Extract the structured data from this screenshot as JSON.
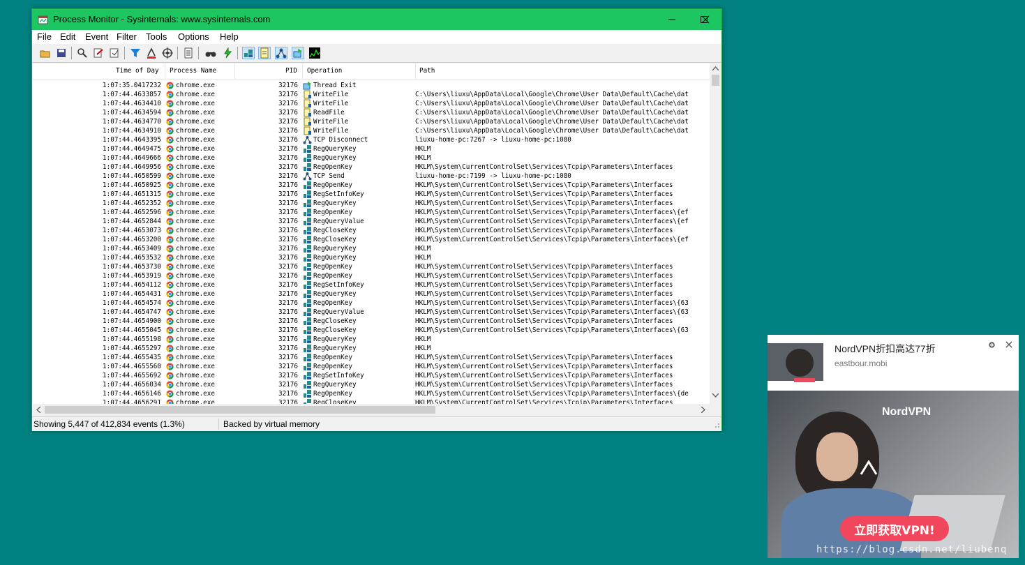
{
  "window": {
    "title": "Process Monitor - Sysinternals: www.sysinternals.com",
    "menu": [
      "File",
      "Edit",
      "Event",
      "Filter",
      "Tools",
      "Options",
      "Help"
    ]
  },
  "toolbar": {
    "icons": [
      "open-icon",
      "save-icon",
      "magnify-icon",
      "capture-icon",
      "autoscroll-icon",
      "clear-icon",
      "filter-icon",
      "highlight-icon",
      "target-icon",
      "tree-icon",
      "find-icon",
      "jump-icon",
      "registry-activity-icon",
      "file-activity-icon",
      "network-activity-icon",
      "process-activity-icon",
      "profiling-icon"
    ]
  },
  "columns": {
    "time": "Time of Day",
    "process": "Process Name",
    "pid": "PID",
    "operation": "Operation",
    "path": "Path"
  },
  "rows": [
    {
      "time": "1:07:35.0417232",
      "process": "chrome.exe",
      "pid": "32176",
      "op": "Thread Exit",
      "path": "",
      "kind": "thread"
    },
    {
      "time": "1:07:44.4633857",
      "process": "chrome.exe",
      "pid": "32176",
      "op": "WriteFile",
      "path": "C:\\Users\\liuxu\\AppData\\Local\\Google\\Chrome\\User Data\\Default\\Cache\\dat",
      "kind": "file"
    },
    {
      "time": "1:07:44.4634410",
      "process": "chrome.exe",
      "pid": "32176",
      "op": "WriteFile",
      "path": "C:\\Users\\liuxu\\AppData\\Local\\Google\\Chrome\\User Data\\Default\\Cache\\dat",
      "kind": "file"
    },
    {
      "time": "1:07:44.4634594",
      "process": "chrome.exe",
      "pid": "32176",
      "op": "ReadFile",
      "path": "C:\\Users\\liuxu\\AppData\\Local\\Google\\Chrome\\User Data\\Default\\Cache\\dat",
      "kind": "file"
    },
    {
      "time": "1:07:44.4634770",
      "process": "chrome.exe",
      "pid": "32176",
      "op": "WriteFile",
      "path": "C:\\Users\\liuxu\\AppData\\Local\\Google\\Chrome\\User Data\\Default\\Cache\\dat",
      "kind": "file"
    },
    {
      "time": "1:07:44.4634910",
      "process": "chrome.exe",
      "pid": "32176",
      "op": "WriteFile",
      "path": "C:\\Users\\liuxu\\AppData\\Local\\Google\\Chrome\\User Data\\Default\\Cache\\dat",
      "kind": "file"
    },
    {
      "time": "1:07:44.4643395",
      "process": "chrome.exe",
      "pid": "32176",
      "op": "TCP Disconnect",
      "path": "liuxu-home-pc:7267 -> liuxu-home-pc:1080",
      "kind": "net"
    },
    {
      "time": "1:07:44.4649475",
      "process": "chrome.exe",
      "pid": "32176",
      "op": "RegQueryKey",
      "path": "HKLM",
      "kind": "reg"
    },
    {
      "time": "1:07:44.4649666",
      "process": "chrome.exe",
      "pid": "32176",
      "op": "RegQueryKey",
      "path": "HKLM",
      "kind": "reg"
    },
    {
      "time": "1:07:44.4649956",
      "process": "chrome.exe",
      "pid": "32176",
      "op": "RegOpenKey",
      "path": "HKLM\\System\\CurrentControlSet\\Services\\Tcpip\\Parameters\\Interfaces",
      "kind": "reg"
    },
    {
      "time": "1:07:44.4650599",
      "process": "chrome.exe",
      "pid": "32176",
      "op": "TCP Send",
      "path": "liuxu-home-pc:7199 -> liuxu-home-pc:1080",
      "kind": "net"
    },
    {
      "time": "1:07:44.4650925",
      "process": "chrome.exe",
      "pid": "32176",
      "op": "RegOpenKey",
      "path": "HKLM\\System\\CurrentControlSet\\Services\\Tcpip\\Parameters\\Interfaces",
      "kind": "reg"
    },
    {
      "time": "1:07:44.4651315",
      "process": "chrome.exe",
      "pid": "32176",
      "op": "RegSetInfoKey",
      "path": "HKLM\\System\\CurrentControlSet\\Services\\Tcpip\\Parameters\\Interfaces",
      "kind": "reg"
    },
    {
      "time": "1:07:44.4652352",
      "process": "chrome.exe",
      "pid": "32176",
      "op": "RegQueryKey",
      "path": "HKLM\\System\\CurrentControlSet\\Services\\Tcpip\\Parameters\\Interfaces",
      "kind": "reg"
    },
    {
      "time": "1:07:44.4652596",
      "process": "chrome.exe",
      "pid": "32176",
      "op": "RegOpenKey",
      "path": "HKLM\\System\\CurrentControlSet\\Services\\Tcpip\\Parameters\\Interfaces\\{ef",
      "kind": "reg"
    },
    {
      "time": "1:07:44.4652844",
      "process": "chrome.exe",
      "pid": "32176",
      "op": "RegQueryValue",
      "path": "HKLM\\System\\CurrentControlSet\\Services\\Tcpip\\Parameters\\Interfaces\\{ef",
      "kind": "reg"
    },
    {
      "time": "1:07:44.4653073",
      "process": "chrome.exe",
      "pid": "32176",
      "op": "RegCloseKey",
      "path": "HKLM\\System\\CurrentControlSet\\Services\\Tcpip\\Parameters\\Interfaces",
      "kind": "reg"
    },
    {
      "time": "1:07:44.4653200",
      "process": "chrome.exe",
      "pid": "32176",
      "op": "RegCloseKey",
      "path": "HKLM\\System\\CurrentControlSet\\Services\\Tcpip\\Parameters\\Interfaces\\{ef",
      "kind": "reg"
    },
    {
      "time": "1:07:44.4653409",
      "process": "chrome.exe",
      "pid": "32176",
      "op": "RegQueryKey",
      "path": "HKLM",
      "kind": "reg"
    },
    {
      "time": "1:07:44.4653532",
      "process": "chrome.exe",
      "pid": "32176",
      "op": "RegQueryKey",
      "path": "HKLM",
      "kind": "reg"
    },
    {
      "time": "1:07:44.4653730",
      "process": "chrome.exe",
      "pid": "32176",
      "op": "RegOpenKey",
      "path": "HKLM\\System\\CurrentControlSet\\Services\\Tcpip\\Parameters\\Interfaces",
      "kind": "reg"
    },
    {
      "time": "1:07:44.4653919",
      "process": "chrome.exe",
      "pid": "32176",
      "op": "RegOpenKey",
      "path": "HKLM\\System\\CurrentControlSet\\Services\\Tcpip\\Parameters\\Interfaces",
      "kind": "reg"
    },
    {
      "time": "1:07:44.4654112",
      "process": "chrome.exe",
      "pid": "32176",
      "op": "RegSetInfoKey",
      "path": "HKLM\\System\\CurrentControlSet\\Services\\Tcpip\\Parameters\\Interfaces",
      "kind": "reg"
    },
    {
      "time": "1:07:44.4654431",
      "process": "chrome.exe",
      "pid": "32176",
      "op": "RegQueryKey",
      "path": "HKLM\\System\\CurrentControlSet\\Services\\Tcpip\\Parameters\\Interfaces",
      "kind": "reg"
    },
    {
      "time": "1:07:44.4654574",
      "process": "chrome.exe",
      "pid": "32176",
      "op": "RegOpenKey",
      "path": "HKLM\\System\\CurrentControlSet\\Services\\Tcpip\\Parameters\\Interfaces\\{63",
      "kind": "reg"
    },
    {
      "time": "1:07:44.4654747",
      "process": "chrome.exe",
      "pid": "32176",
      "op": "RegQueryValue",
      "path": "HKLM\\System\\CurrentControlSet\\Services\\Tcpip\\Parameters\\Interfaces\\{63",
      "kind": "reg"
    },
    {
      "time": "1:07:44.4654900",
      "process": "chrome.exe",
      "pid": "32176",
      "op": "RegCloseKey",
      "path": "HKLM\\System\\CurrentControlSet\\Services\\Tcpip\\Parameters\\Interfaces",
      "kind": "reg"
    },
    {
      "time": "1:07:44.4655045",
      "process": "chrome.exe",
      "pid": "32176",
      "op": "RegCloseKey",
      "path": "HKLM\\System\\CurrentControlSet\\Services\\Tcpip\\Parameters\\Interfaces\\{63",
      "kind": "reg"
    },
    {
      "time": "1:07:44.4655198",
      "process": "chrome.exe",
      "pid": "32176",
      "op": "RegQueryKey",
      "path": "HKLM",
      "kind": "reg"
    },
    {
      "time": "1:07:44.4655297",
      "process": "chrome.exe",
      "pid": "32176",
      "op": "RegQueryKey",
      "path": "HKLM",
      "kind": "reg"
    },
    {
      "time": "1:07:44.4655435",
      "process": "chrome.exe",
      "pid": "32176",
      "op": "RegOpenKey",
      "path": "HKLM\\System\\CurrentControlSet\\Services\\Tcpip\\Parameters\\Interfaces",
      "kind": "reg"
    },
    {
      "time": "1:07:44.4655560",
      "process": "chrome.exe",
      "pid": "32176",
      "op": "RegOpenKey",
      "path": "HKLM\\System\\CurrentControlSet\\Services\\Tcpip\\Parameters\\Interfaces",
      "kind": "reg"
    },
    {
      "time": "1:07:44.4655692",
      "process": "chrome.exe",
      "pid": "32176",
      "op": "RegSetInfoKey",
      "path": "HKLM\\System\\CurrentControlSet\\Services\\Tcpip\\Parameters\\Interfaces",
      "kind": "reg"
    },
    {
      "time": "1:07:44.4656034",
      "process": "chrome.exe",
      "pid": "32176",
      "op": "RegQueryKey",
      "path": "HKLM\\System\\CurrentControlSet\\Services\\Tcpip\\Parameters\\Interfaces",
      "kind": "reg"
    },
    {
      "time": "1:07:44.4656146",
      "process": "chrome.exe",
      "pid": "32176",
      "op": "RegOpenKey",
      "path": "HKLM\\System\\CurrentControlSet\\Services\\Tcpip\\Parameters\\Interfaces\\{de",
      "kind": "reg"
    },
    {
      "time": "1:07:44.4656291",
      "process": "chrome.exe",
      "pid": "32176",
      "op": "RegCloseKey",
      "path": "HKLM\\System\\CurrentControlSet\\Services\\Tcpip\\Parameters\\Interfaces",
      "kind": "reg"
    }
  ],
  "status": {
    "events": "Showing 5,447 of 412,834 events (1.3%)",
    "memory": "Backed by virtual memory"
  },
  "ad": {
    "title": "NordVPN折扣高达77折",
    "site": "eastbour.mobi",
    "brand": "NordVPN",
    "cta": "立即获取VPN!"
  },
  "watermark": "https://blog.csdn.net/liubenq",
  "colors": {
    "desktop": "#008080",
    "titlebar": "#1ec661",
    "cta": "#f0475d"
  }
}
